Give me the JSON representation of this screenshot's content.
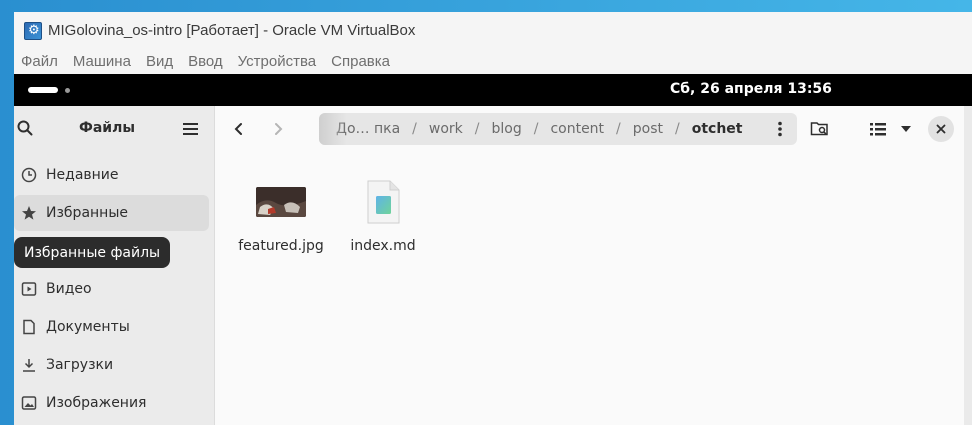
{
  "host": {
    "window_title": "MIGolovina_os-intro [Работает] - Oracle VM VirtualBox",
    "menu": [
      "Файл",
      "Машина",
      "Вид",
      "Ввод",
      "Устройства",
      "Справка"
    ]
  },
  "topbar": {
    "clock": "Сб, 26 апреля  13:56"
  },
  "sidebar": {
    "title": "Файлы",
    "items": [
      {
        "label": "Недавние",
        "icon": "clock-icon"
      },
      {
        "label": "Избранные",
        "icon": "star-icon"
      },
      {
        "label": "Видео",
        "icon": "video-icon"
      },
      {
        "label": "Документы",
        "icon": "document-icon"
      },
      {
        "label": "Загрузки",
        "icon": "download-icon"
      },
      {
        "label": "Изображения",
        "icon": "image-icon"
      }
    ],
    "tooltip": "Избранные файлы"
  },
  "pathbar": {
    "crumbs": [
      "До… пка",
      "work",
      "blog",
      "content",
      "post",
      "otchet"
    ],
    "separator": "/"
  },
  "files": [
    {
      "name": "featured.jpg",
      "type": "image"
    },
    {
      "name": "index.md",
      "type": "markdown"
    }
  ],
  "colors": {
    "desktop_blue": "#2a8fd0",
    "sidebar_bg": "#ebebeb",
    "content_bg": "#fafafa",
    "topbar_bg": "#000000"
  }
}
